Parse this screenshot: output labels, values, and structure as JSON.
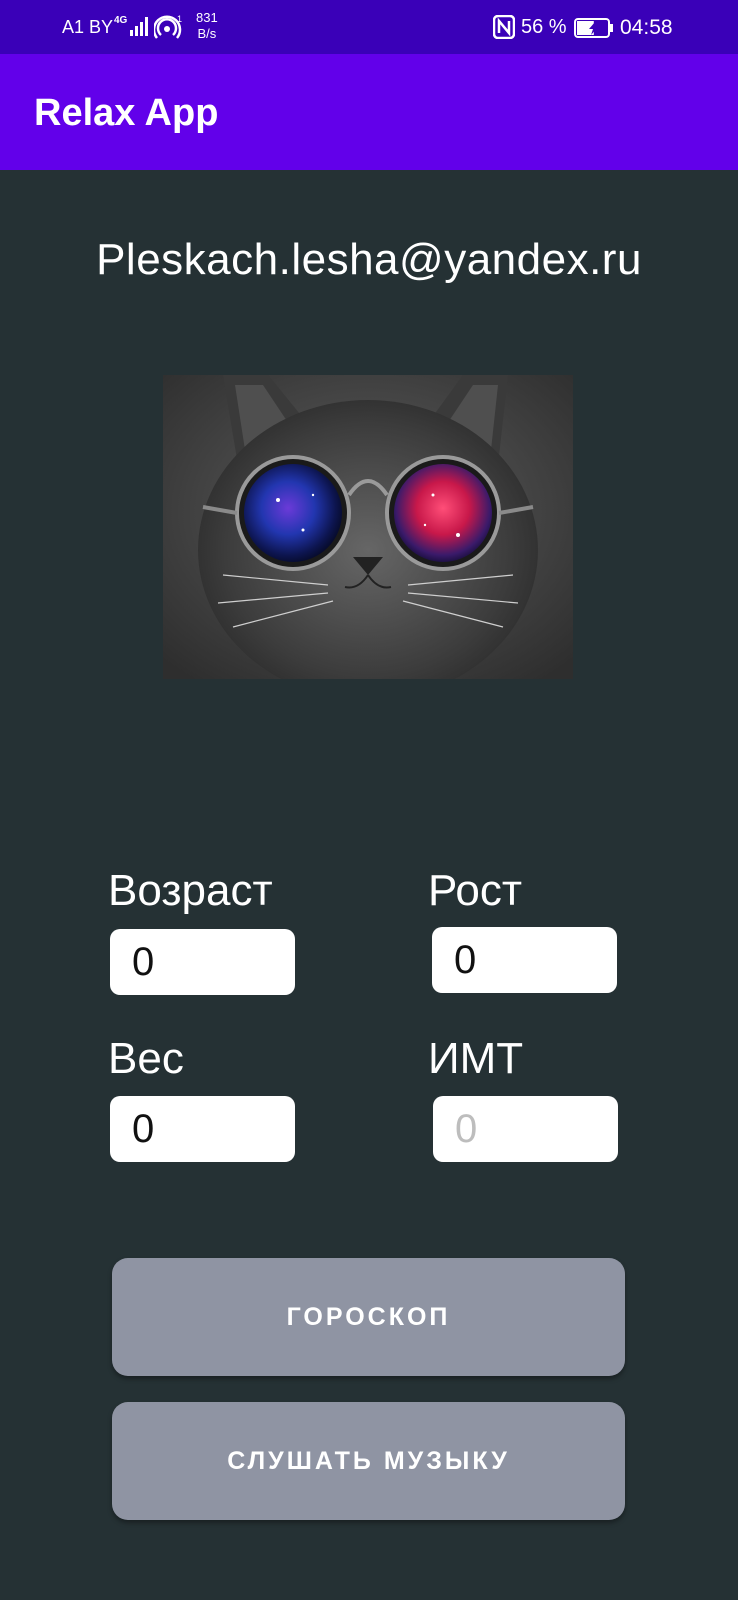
{
  "status_bar": {
    "carrier": "A1 BY",
    "network_icon": "signal-4g-icon",
    "hotspot_icon": "wifi-hotspot-icon",
    "hotspot_count": "1",
    "speed_value": "831",
    "speed_unit": "B/s",
    "nfc_icon": "nfc-icon",
    "battery_percent": "56 %",
    "battery_icon": "battery-charging-icon",
    "battery_level": 0.56,
    "time": "04:58"
  },
  "app_bar": {
    "title": "Relax App"
  },
  "profile": {
    "email": "Pleskach.lesha@yandex.ru"
  },
  "image": {
    "subject": "cat-with-galaxy-glasses"
  },
  "form": {
    "age": {
      "label": "Возраст",
      "value": "0"
    },
    "height": {
      "label": "Рост",
      "value": "0"
    },
    "weight": {
      "label": "Вес",
      "value": "0"
    },
    "bmi": {
      "label": "ИМТ",
      "placeholder": "0"
    }
  },
  "buttons": {
    "horoscope": "ГОРОСКОП",
    "music": "СЛУШАТЬ МУЗЫКУ"
  },
  "colors": {
    "status_bar": "#3a00b8",
    "app_bar": "#6200ea",
    "background": "#253134",
    "button": "#8f94a3"
  }
}
